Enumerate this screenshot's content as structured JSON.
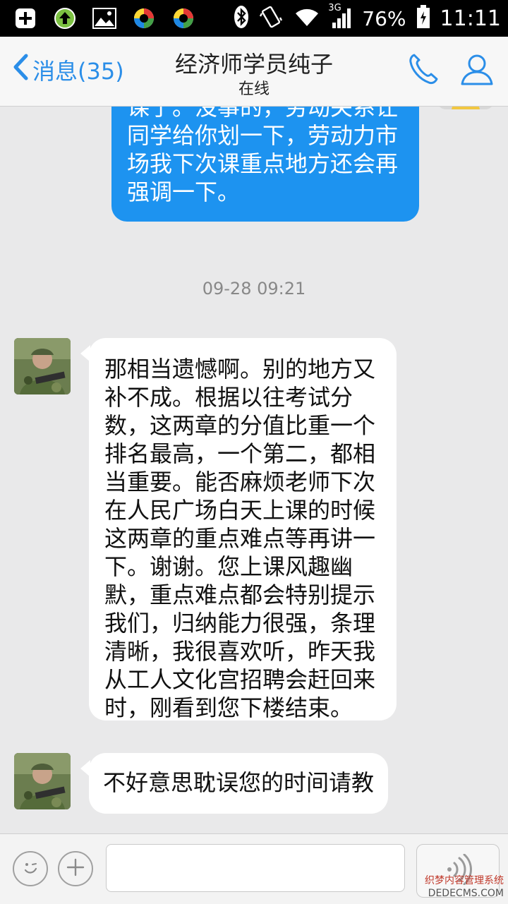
{
  "status_bar": {
    "icons": [
      "add-icon",
      "upload-icon",
      "gallery-icon",
      "app-icon",
      "app-icon"
    ],
    "network": "3G",
    "battery": "76%",
    "time": "11:11"
  },
  "header": {
    "back_label": "消息(35)",
    "title": "经济师学员纯子",
    "subtitle": "在线"
  },
  "messages": [
    {
      "direction": "out",
      "lines": [
        "课了。没事的，劳动关系让",
        "同学给你划一下，劳动力市",
        "场我下次课重点地方还会再",
        "强调一下。"
      ]
    },
    {
      "timestamp": "09-28 09:21"
    },
    {
      "direction": "in",
      "lines": [
        "那相当遗憾啊。别的地方又",
        "补不成。根据以往考试分",
        "数，这两章的分值比重一个",
        "排名最高，一个第二，都相",
        "当重要。能否麻烦老师下次",
        "在人民广场白天上课的时候",
        "这两章的重点难点等再讲一",
        "下。谢谢。您上课风趣幽",
        "默，重点难点都会特别提示",
        "我们，归纳能力很强，条理",
        "清晰，我很喜欢听，昨天我",
        "从工人文化宫招聘会赶回来",
        "时，刚看到您下楼结束。"
      ]
    },
    {
      "direction": "in",
      "lines": [
        "不好意思耽误您的时间请教"
      ]
    }
  ],
  "input": {
    "value": ""
  },
  "watermark": {
    "line1": "织梦内容管理系统",
    "line2": "DEDECMS.COM"
  },
  "colors": {
    "accent": "#2b8ee8",
    "outgoing_bubble": "#1d93f0",
    "background": "#e9e9ea"
  }
}
